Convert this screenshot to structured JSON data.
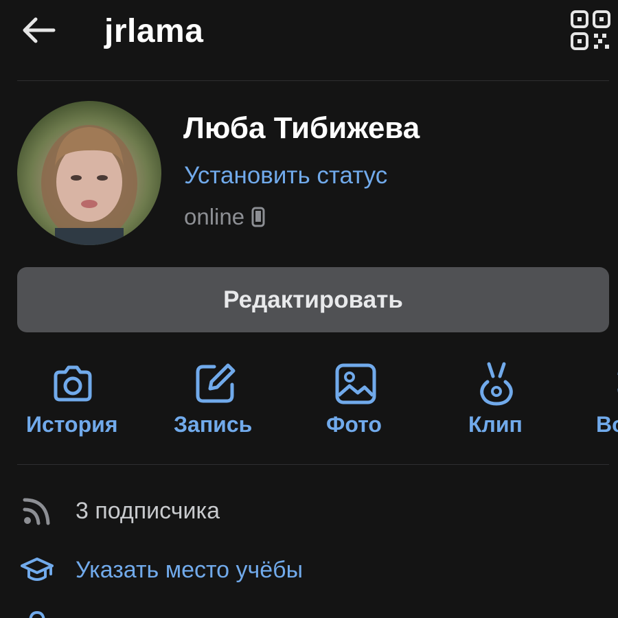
{
  "header": {
    "username": "jrlama",
    "back_icon": "arrow-left-icon",
    "qr_icon": "qr-code-icon"
  },
  "profile": {
    "name": "Люба Тибижева",
    "set_status": "Установить статус",
    "online": "online",
    "online_device_icon": "phone-icon"
  },
  "edit_button": {
    "label": "Редактировать"
  },
  "actions": [
    {
      "label": "История",
      "icon": "camera-icon"
    },
    {
      "label": "Запись",
      "icon": "edit-note-icon"
    },
    {
      "label": "Фото",
      "icon": "photo-icon"
    },
    {
      "label": "Клип",
      "icon": "clip-icon"
    },
    {
      "label": "Во",
      "icon": "voice-icon"
    }
  ],
  "info": {
    "followers": {
      "text": "3 подписчика",
      "icon": "rss-icon"
    },
    "education": {
      "text": "Указать место учёбы",
      "icon": "graduation-cap-icon"
    }
  },
  "colors": {
    "background": "#141414",
    "accent": "#71aaeb",
    "button": "#505154",
    "muted": "#8d8f94"
  }
}
